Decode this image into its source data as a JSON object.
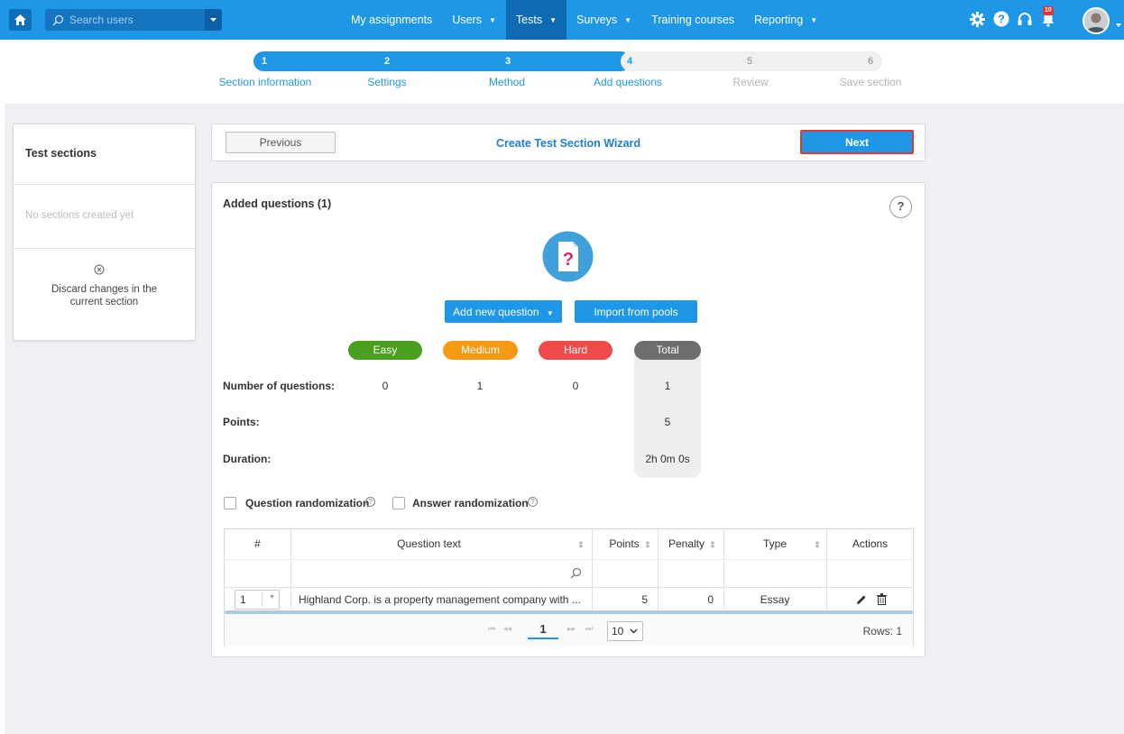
{
  "topbar": {
    "search_placeholder": "Search users",
    "nav": [
      {
        "label": "My assignments",
        "dropdown": false
      },
      {
        "label": "Users",
        "dropdown": true
      },
      {
        "label": "Tests",
        "dropdown": true,
        "active": true
      },
      {
        "label": "Surveys",
        "dropdown": true
      },
      {
        "label": "Training courses",
        "dropdown": false
      },
      {
        "label": "Reporting",
        "dropdown": true
      }
    ],
    "notification_count": "10",
    "accent": "#1e97e6"
  },
  "stepper": {
    "steps": [
      {
        "num": "1",
        "label": "Section information",
        "state": "done"
      },
      {
        "num": "2",
        "label": "Settings",
        "state": "done"
      },
      {
        "num": "3",
        "label": "Method",
        "state": "done"
      },
      {
        "num": "4",
        "label": "Add questions",
        "state": "current"
      },
      {
        "num": "5",
        "label": "Review",
        "state": "future"
      },
      {
        "num": "6",
        "label": "Save section",
        "state": "future"
      }
    ]
  },
  "left_panel": {
    "title": "Test sections",
    "empty_text": "No sections created yet",
    "discard_line1": "Discard changes in the",
    "discard_line2": "current section"
  },
  "wizard": {
    "previous_label": "Previous",
    "title": "Create Test Section Wizard",
    "next_label": "Next"
  },
  "card": {
    "title": "Added questions (1)",
    "help": "?",
    "add_question_label": "Add new question",
    "import_label": "Import from pools",
    "difficulty": [
      {
        "label": "Easy",
        "color": "#4aa01e"
      },
      {
        "label": "Medium",
        "color": "#f59a12"
      },
      {
        "label": "Hard",
        "color": "#ef4b4b"
      },
      {
        "label": "Total",
        "color": "#6e6e6e"
      }
    ],
    "rows": {
      "questions_label": "Number of questions:",
      "points_label": "Points:",
      "duration_label": "Duration:",
      "questions": {
        "easy": "0",
        "medium": "1",
        "hard": "0",
        "total": "1"
      },
      "points_total": "5",
      "duration_total": "2h 0m 0s"
    },
    "question_randomization": "Question randomization",
    "answer_randomization": "Answer randomization"
  },
  "table": {
    "headers": {
      "num": "#",
      "question_text": "Question text",
      "points": "Points",
      "penalty": "Penalty",
      "type": "Type",
      "actions": "Actions"
    },
    "rows": [
      {
        "num": "1",
        "question_text": "Highland Corp. is a property management company with ...",
        "points": "5",
        "penalty": "0",
        "type": "Essay"
      }
    ],
    "page": "1",
    "page_size": "10",
    "rows_count": "Rows: 1"
  }
}
